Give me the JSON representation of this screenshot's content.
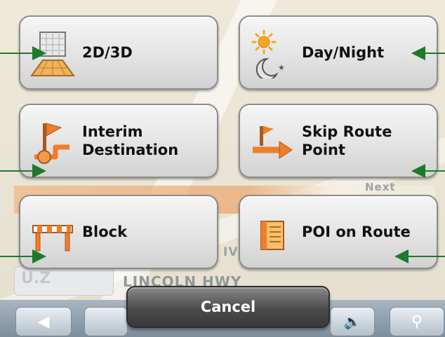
{
  "menu": {
    "buttons": [
      {
        "id": "2d3d",
        "label": "2D/3D",
        "icon": "2d-3d-view-icon"
      },
      {
        "id": "day-night",
        "label": "Day/Night",
        "icon": "day-night-icon"
      },
      {
        "id": "interim",
        "label": "Interim\nDestination",
        "icon": "interim-destination-icon"
      },
      {
        "id": "skip",
        "label": "Skip Route\nPoint",
        "icon": "skip-route-point-icon"
      },
      {
        "id": "block",
        "label": "Block",
        "icon": "block-road-icon"
      },
      {
        "id": "poi",
        "label": "POI on Route",
        "icon": "poi-list-icon"
      }
    ],
    "cancel_label": "Cancel"
  },
  "map": {
    "street_name": "LINCOLN HWY",
    "distance_partial": "U.Z",
    "next_partial": "Next",
    "street_partial": "IV"
  },
  "colors": {
    "callout_arrow": "#1d7a2a",
    "button_face": "#e6e6e6",
    "cancel_face": "#4b4b4b"
  }
}
